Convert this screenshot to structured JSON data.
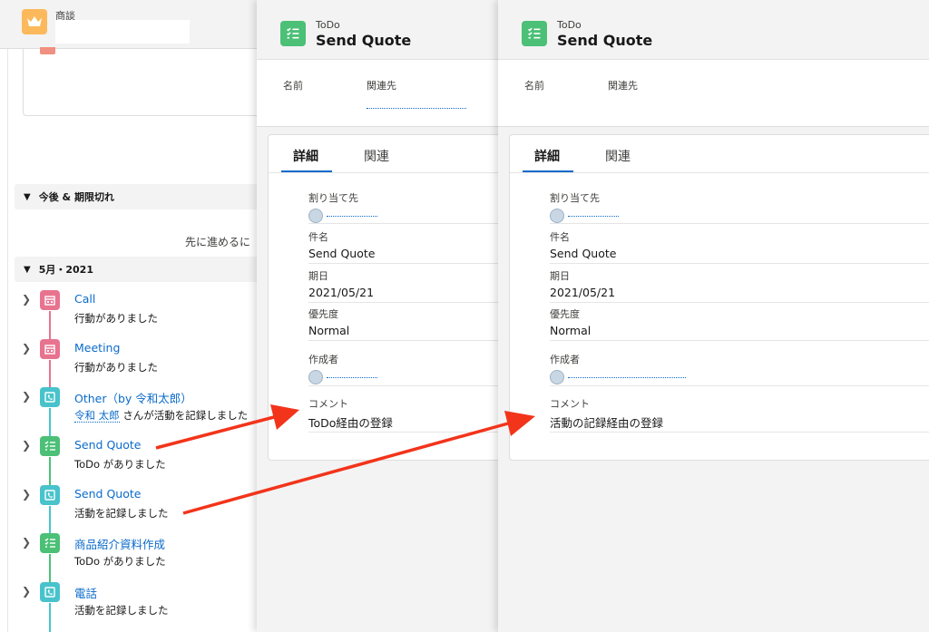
{
  "opportunity": {
    "object_label": "商談",
    "more_message": "先に進めるに"
  },
  "sections": {
    "upcoming": "今後 & 期限切れ",
    "month": "5月・2021"
  },
  "timeline": [
    {
      "icon": "calendar-icon",
      "color": "#e8738f",
      "title": "Call",
      "sub": "行動がありました"
    },
    {
      "icon": "calendar-icon",
      "color": "#e8738f",
      "title": "Meeting",
      "sub": "行動がありました"
    },
    {
      "icon": "phone-log-icon",
      "color": "#48c3cc",
      "title": "Other（by 令和太郎）",
      "sub_link": "令和 太郎",
      "sub": "さんが活動を記録しました"
    },
    {
      "icon": "task-icon",
      "color": "#4bc076",
      "title": "Send Quote",
      "sub": "ToDo がありました"
    },
    {
      "icon": "phone-log-icon",
      "color": "#48c3cc",
      "title": "Send Quote",
      "sub": "活動を記録しました"
    },
    {
      "icon": "task-icon",
      "color": "#4bc076",
      "title": "商品紹介資料作成",
      "sub": "ToDo がありました"
    },
    {
      "icon": "phone-log-icon",
      "color": "#48c3cc",
      "title": "電話",
      "sub": "活動を記録しました"
    }
  ],
  "panel1": {
    "type": "ToDo",
    "title": "Send Quote",
    "header_fields": {
      "name": "名前",
      "related": "関連先"
    },
    "tabs": {
      "details": "詳細",
      "related": "関連"
    },
    "fields": {
      "assigned_label": "割り当て先",
      "subject_label": "件名",
      "subject": "Send Quote",
      "due_label": "期日",
      "due": "2021/05/21",
      "priority_label": "優先度",
      "priority": "Normal",
      "creator_label": "作成者",
      "comment_label": "コメント",
      "comment": "ToDo経由の登録"
    }
  },
  "panel2": {
    "type": "ToDo",
    "title": "Send Quote",
    "header_fields": {
      "name": "名前",
      "related": "関連先"
    },
    "tabs": {
      "details": "詳細",
      "related": "関連"
    },
    "fields": {
      "assigned_label": "割り当て先",
      "subject_label": "件名",
      "subject": "Send Quote",
      "due_label": "期日",
      "due": "2021/05/21",
      "priority_label": "優先度",
      "priority": "Normal",
      "creator_label": "作成者",
      "comment_label": "コメント",
      "comment": "活動の記録経由の登録"
    }
  },
  "colors": {
    "link": "#0b6bcb",
    "arrow": "#f2341b",
    "task": "#4bc076",
    "call_log": "#48c3cc",
    "event": "#e8738f",
    "opportunity": "#fcb95b"
  }
}
